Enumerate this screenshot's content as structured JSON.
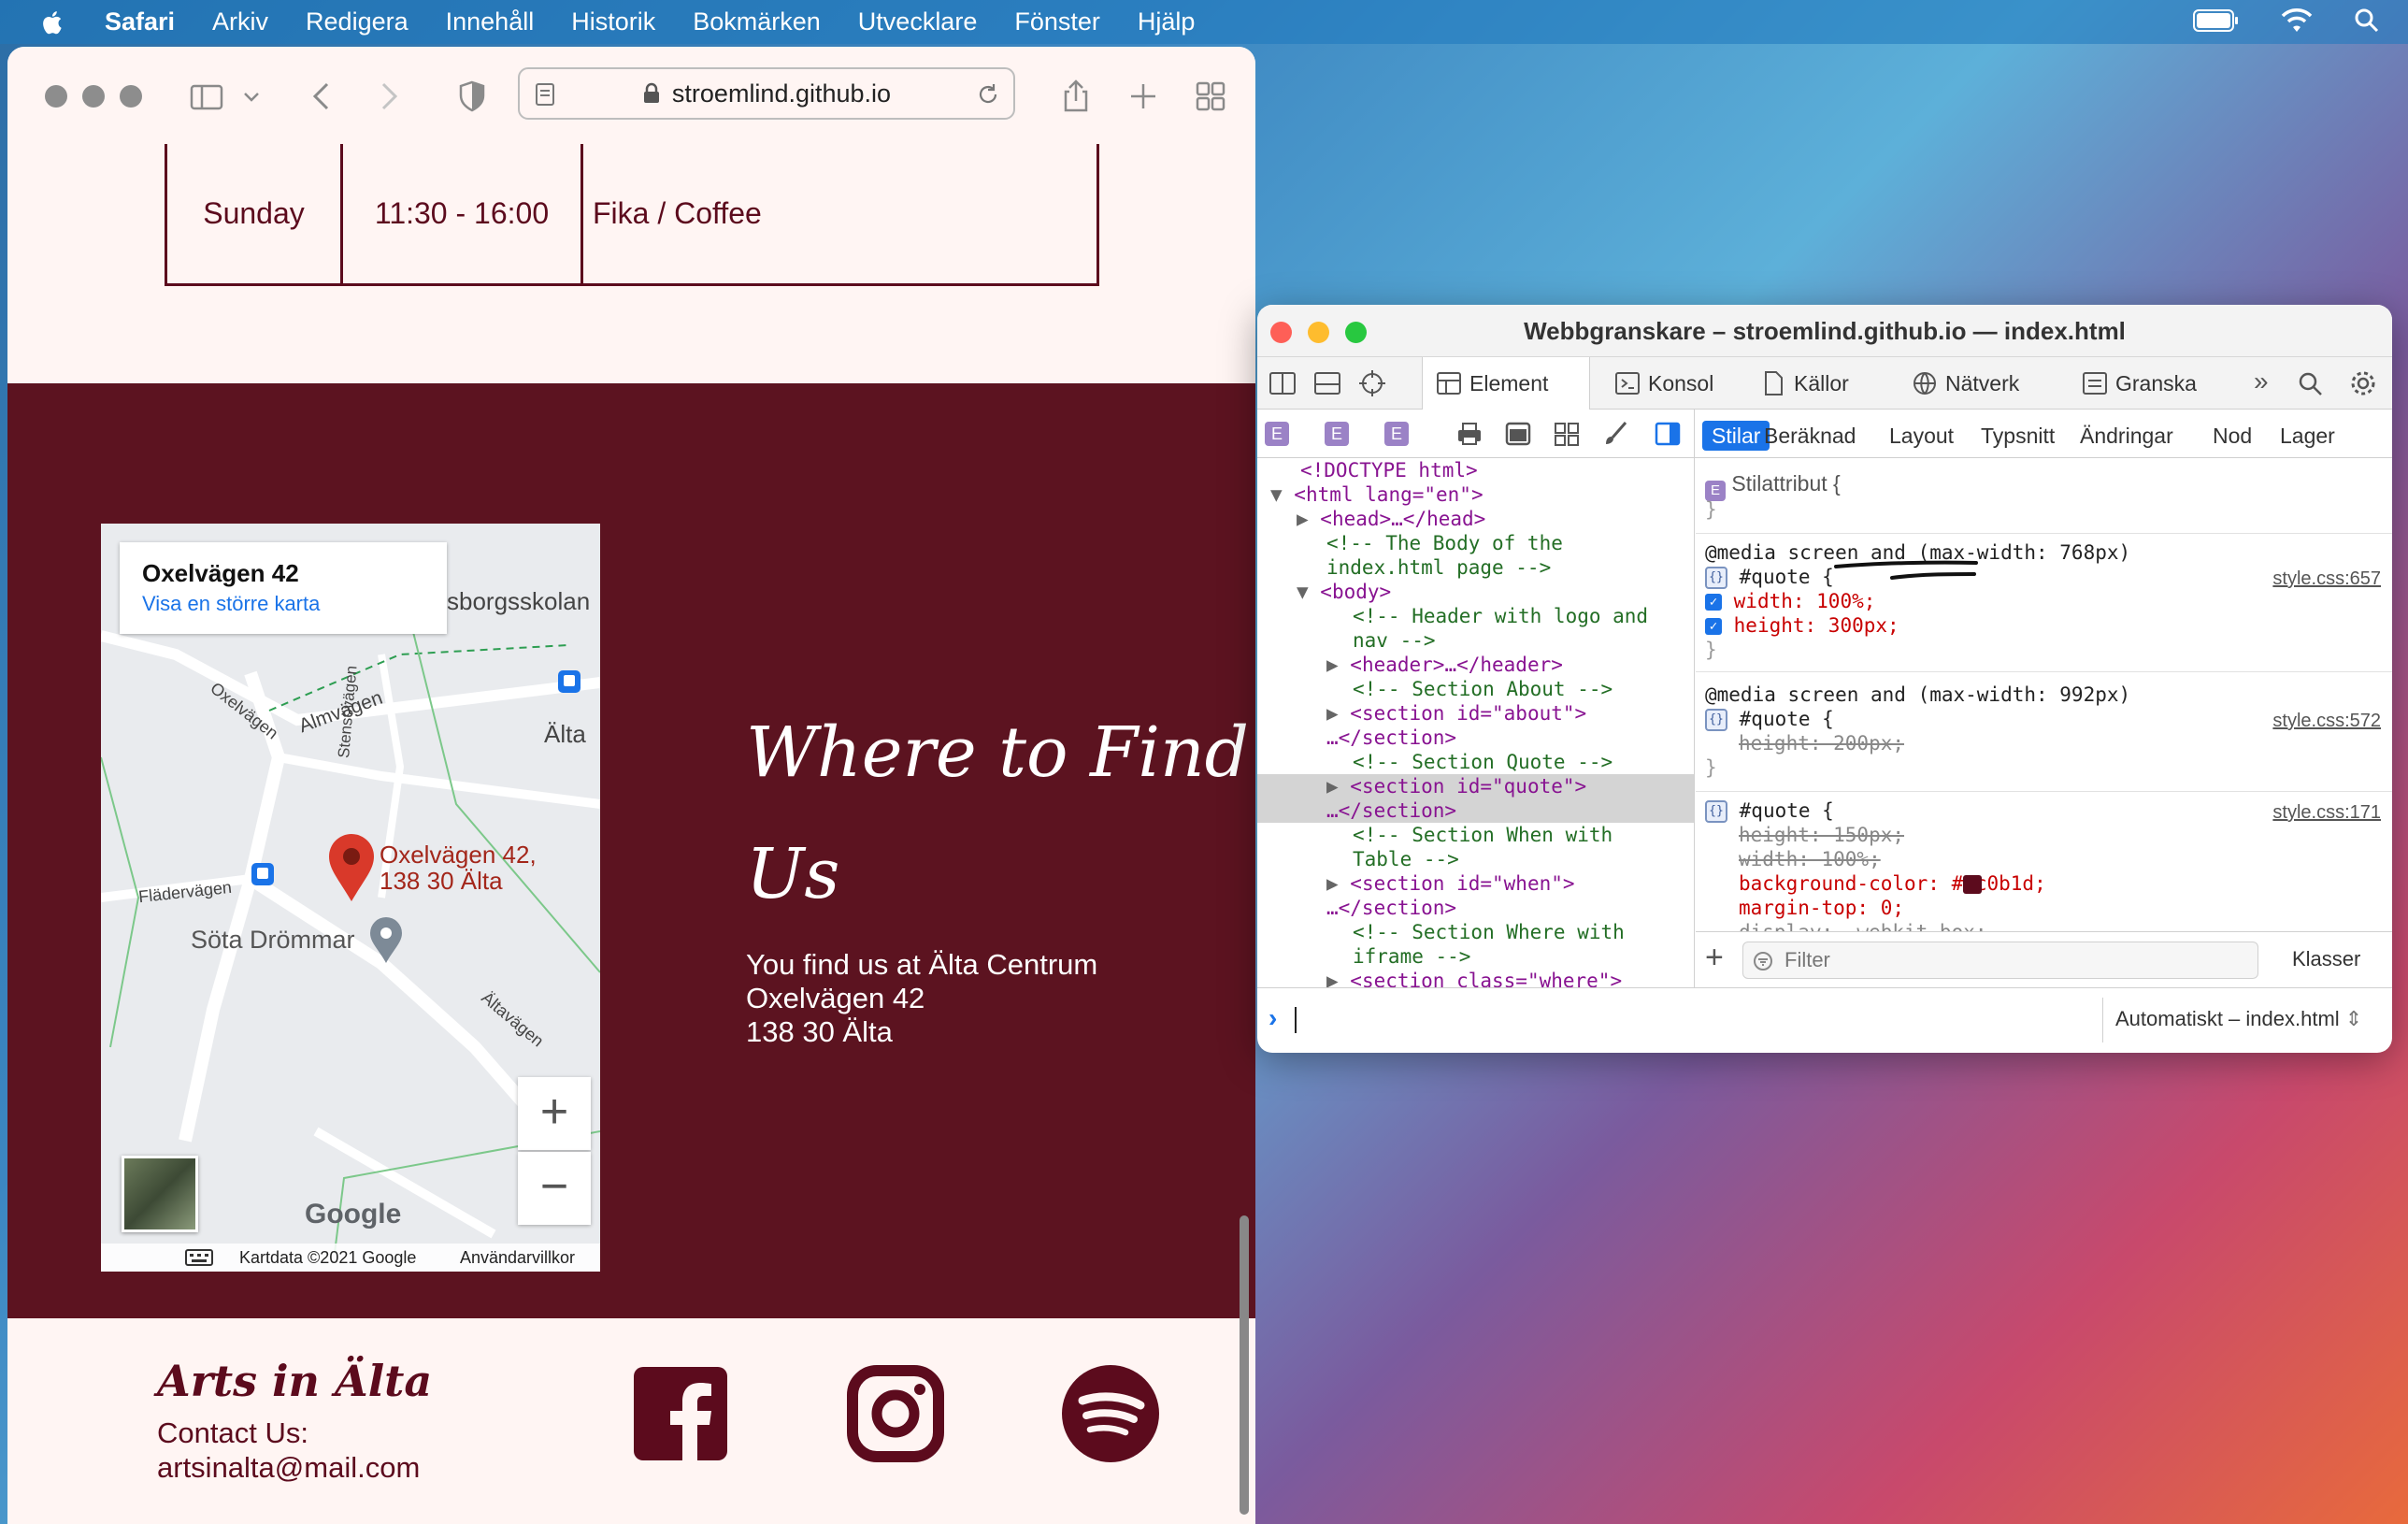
{
  "menubar": {
    "app": "Safari",
    "items": [
      "Arkiv",
      "Redigera",
      "Innehåll",
      "Historik",
      "Bokmärken",
      "Utvecklare",
      "Fönster",
      "Hjälp"
    ]
  },
  "safari": {
    "url": "stroemlind.github.io"
  },
  "page": {
    "hours_row": [
      "Sunday",
      "11:30 - 16:00",
      "Fika / Coffee"
    ],
    "map": {
      "card_title": "Oxelvägen 42",
      "card_link": "Visa en större karta",
      "pin_label_1": "Oxelvägen 42,",
      "pin_label_2": "138 30 Älta",
      "place_label": "Söta Drömmar",
      "labels": [
        "sborgsskolan",
        "Älta",
        "Almvägen",
        "Oxelvägen",
        "Stensövägen",
        "Flädervägen",
        "Ältavägen"
      ],
      "google": "Google",
      "attribution": "Kartdata ©2021 Google",
      "terms": "Användarvillkor",
      "zoom_in": "+",
      "zoom_out": "−"
    },
    "where_title": "Where to Find Us",
    "where_lines": [
      "You find us at Älta Centrum",
      "Oxelvägen 42",
      "138 30 Älta"
    ],
    "footer": {
      "title": "Arts in Älta",
      "contact_label": "Contact Us:",
      "email": "artsinalta@mail.com",
      "social_icons": [
        "facebook-icon",
        "instagram-icon",
        "spotify-icon"
      ]
    }
  },
  "inspector": {
    "title": "Webbgranskare – stroemlind.github.io — index.html",
    "tabs": [
      "Element",
      "Konsol",
      "Källor",
      "Nätverk",
      "Granska"
    ],
    "style_tabs": [
      "Stilar",
      "Beräknad",
      "Layout",
      "Typsnitt",
      "Ändringar",
      "Nod",
      "Lager"
    ],
    "dom_lines": [
      "<!DOCTYPE html>",
      "<html lang=\"en\">",
      "<head>…</head>",
      "<!-- The Body of the",
      "index.html page -->",
      "<body>",
      "<!-- Header with logo and",
      "nav -->",
      "<header>…</header>",
      "<!-- Section About -->",
      "<section id=\"about\">",
      "…</section>",
      "<!-- Section Quote -->",
      "<section id=\"quote\">",
      "…</section>",
      "<!-- Section When with",
      "Table -->",
      "<section id=\"when\">",
      "…</section>",
      "<!-- Section Where with",
      "iframe -->",
      "<section class=\"where\">"
    ],
    "styles": {
      "style_attr": "Stilattribut {",
      "rule1_media": "@media screen and (max-width: 768px)",
      "rule1_selector": "#quote {",
      "rule1_src": "style.css:657",
      "rule1_props": [
        "width: 100%;",
        "height: 300px;"
      ],
      "rule2_media": "@media screen and (max-width: 992px)",
      "rule2_selector": "#quote {",
      "rule2_src": "style.css:572",
      "rule2_props": [
        "height: 200px;"
      ],
      "rule3_selector": "#quote {",
      "rule3_src": "style.css:171",
      "rule3_props": [
        "height: 150px;",
        "width: 100%;",
        "background-color: #5c0b1d;",
        "margin-top: 0;",
        "display: -webkit-box;"
      ],
      "close": "}",
      "swatch": "#5c0b1d"
    },
    "filter_placeholder": "Filter",
    "classes_label": "Klasser",
    "console_context": "Automatiskt – index.html"
  },
  "colors": {
    "brand": "#5c0b1d",
    "section_bg": "#5c1320",
    "page_bg": "#fff5f3"
  }
}
